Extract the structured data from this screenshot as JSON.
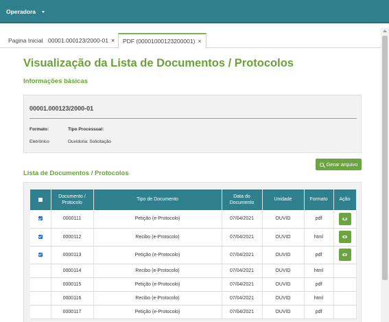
{
  "topbar": {
    "menu_label": "Operadora"
  },
  "tabs": [
    {
      "label": "Pagina Inicial",
      "closable": false
    },
    {
      "label": "00001.000123/2000-01",
      "closable": true,
      "close": "×"
    },
    {
      "label": "PDF (00001000123200001)",
      "closable": true,
      "close": "×",
      "active": true
    }
  ],
  "page": {
    "title": "Visualização da Lista de Documentos / Protocolos",
    "basic_info_title": "Informações básicas",
    "list_title": "Lista de Documentos / Protocolos"
  },
  "info": {
    "process_number": "00001.000123/2000-01",
    "format_label": "Formato:",
    "format_value": "Eletrônico",
    "type_label": "Tipo Processual:",
    "type_value": "Ouvidoria: Solicitação"
  },
  "actions": {
    "generate_label": "Gerar arquivo"
  },
  "table": {
    "headers": {
      "document_line1": "Documento /",
      "document_line2": "Protocolo",
      "type": "Tipo de Documento",
      "date_line1": "Data do",
      "date_line2": "Documento",
      "unit": "Unidade",
      "format": "Formato",
      "action": "Ação"
    },
    "rows": [
      {
        "checked": true,
        "doc": "0000111",
        "type": "Petição (e-Protocolo)",
        "date": "07/04/2021",
        "unit": "OUVID",
        "format": "pdf",
        "has_action": true
      },
      {
        "checked": true,
        "doc": "0000112",
        "type": "Recibo (e-Protocolo)",
        "date": "07/04/2021",
        "unit": "OUVID",
        "format": "html",
        "has_action": true
      },
      {
        "checked": true,
        "doc": "0000113",
        "type": "Petição (e-Protocolo)",
        "date": "07/04/2021",
        "unit": "OUVID",
        "format": "pdf",
        "has_action": true
      },
      {
        "checked": false,
        "doc": "0000114",
        "type": "Recibo (e-Protocolo)",
        "date": "07/04/2021",
        "unit": "OUVID",
        "format": "html",
        "has_action": false
      },
      {
        "checked": false,
        "doc": "0000115",
        "type": "Petição (e-Protocolo)",
        "date": "07/04/2021",
        "unit": "OUVID",
        "format": "pdf",
        "has_action": false
      },
      {
        "checked": false,
        "doc": "0000116",
        "type": "Recibo (e-Protocolo)",
        "date": "07/04/2021",
        "unit": "OUVID",
        "format": "html",
        "has_action": false
      },
      {
        "checked": false,
        "doc": "0000117",
        "type": "Petição (e-Protocolo)",
        "date": "07/04/2021",
        "unit": "OUVID",
        "format": "pdf",
        "has_action": false
      }
    ]
  },
  "colors": {
    "topbar": "#2f7f8c",
    "accent_green": "#6ba540",
    "title_green": "#6aa13a",
    "checkbox_blue": "#1a6ed8"
  }
}
